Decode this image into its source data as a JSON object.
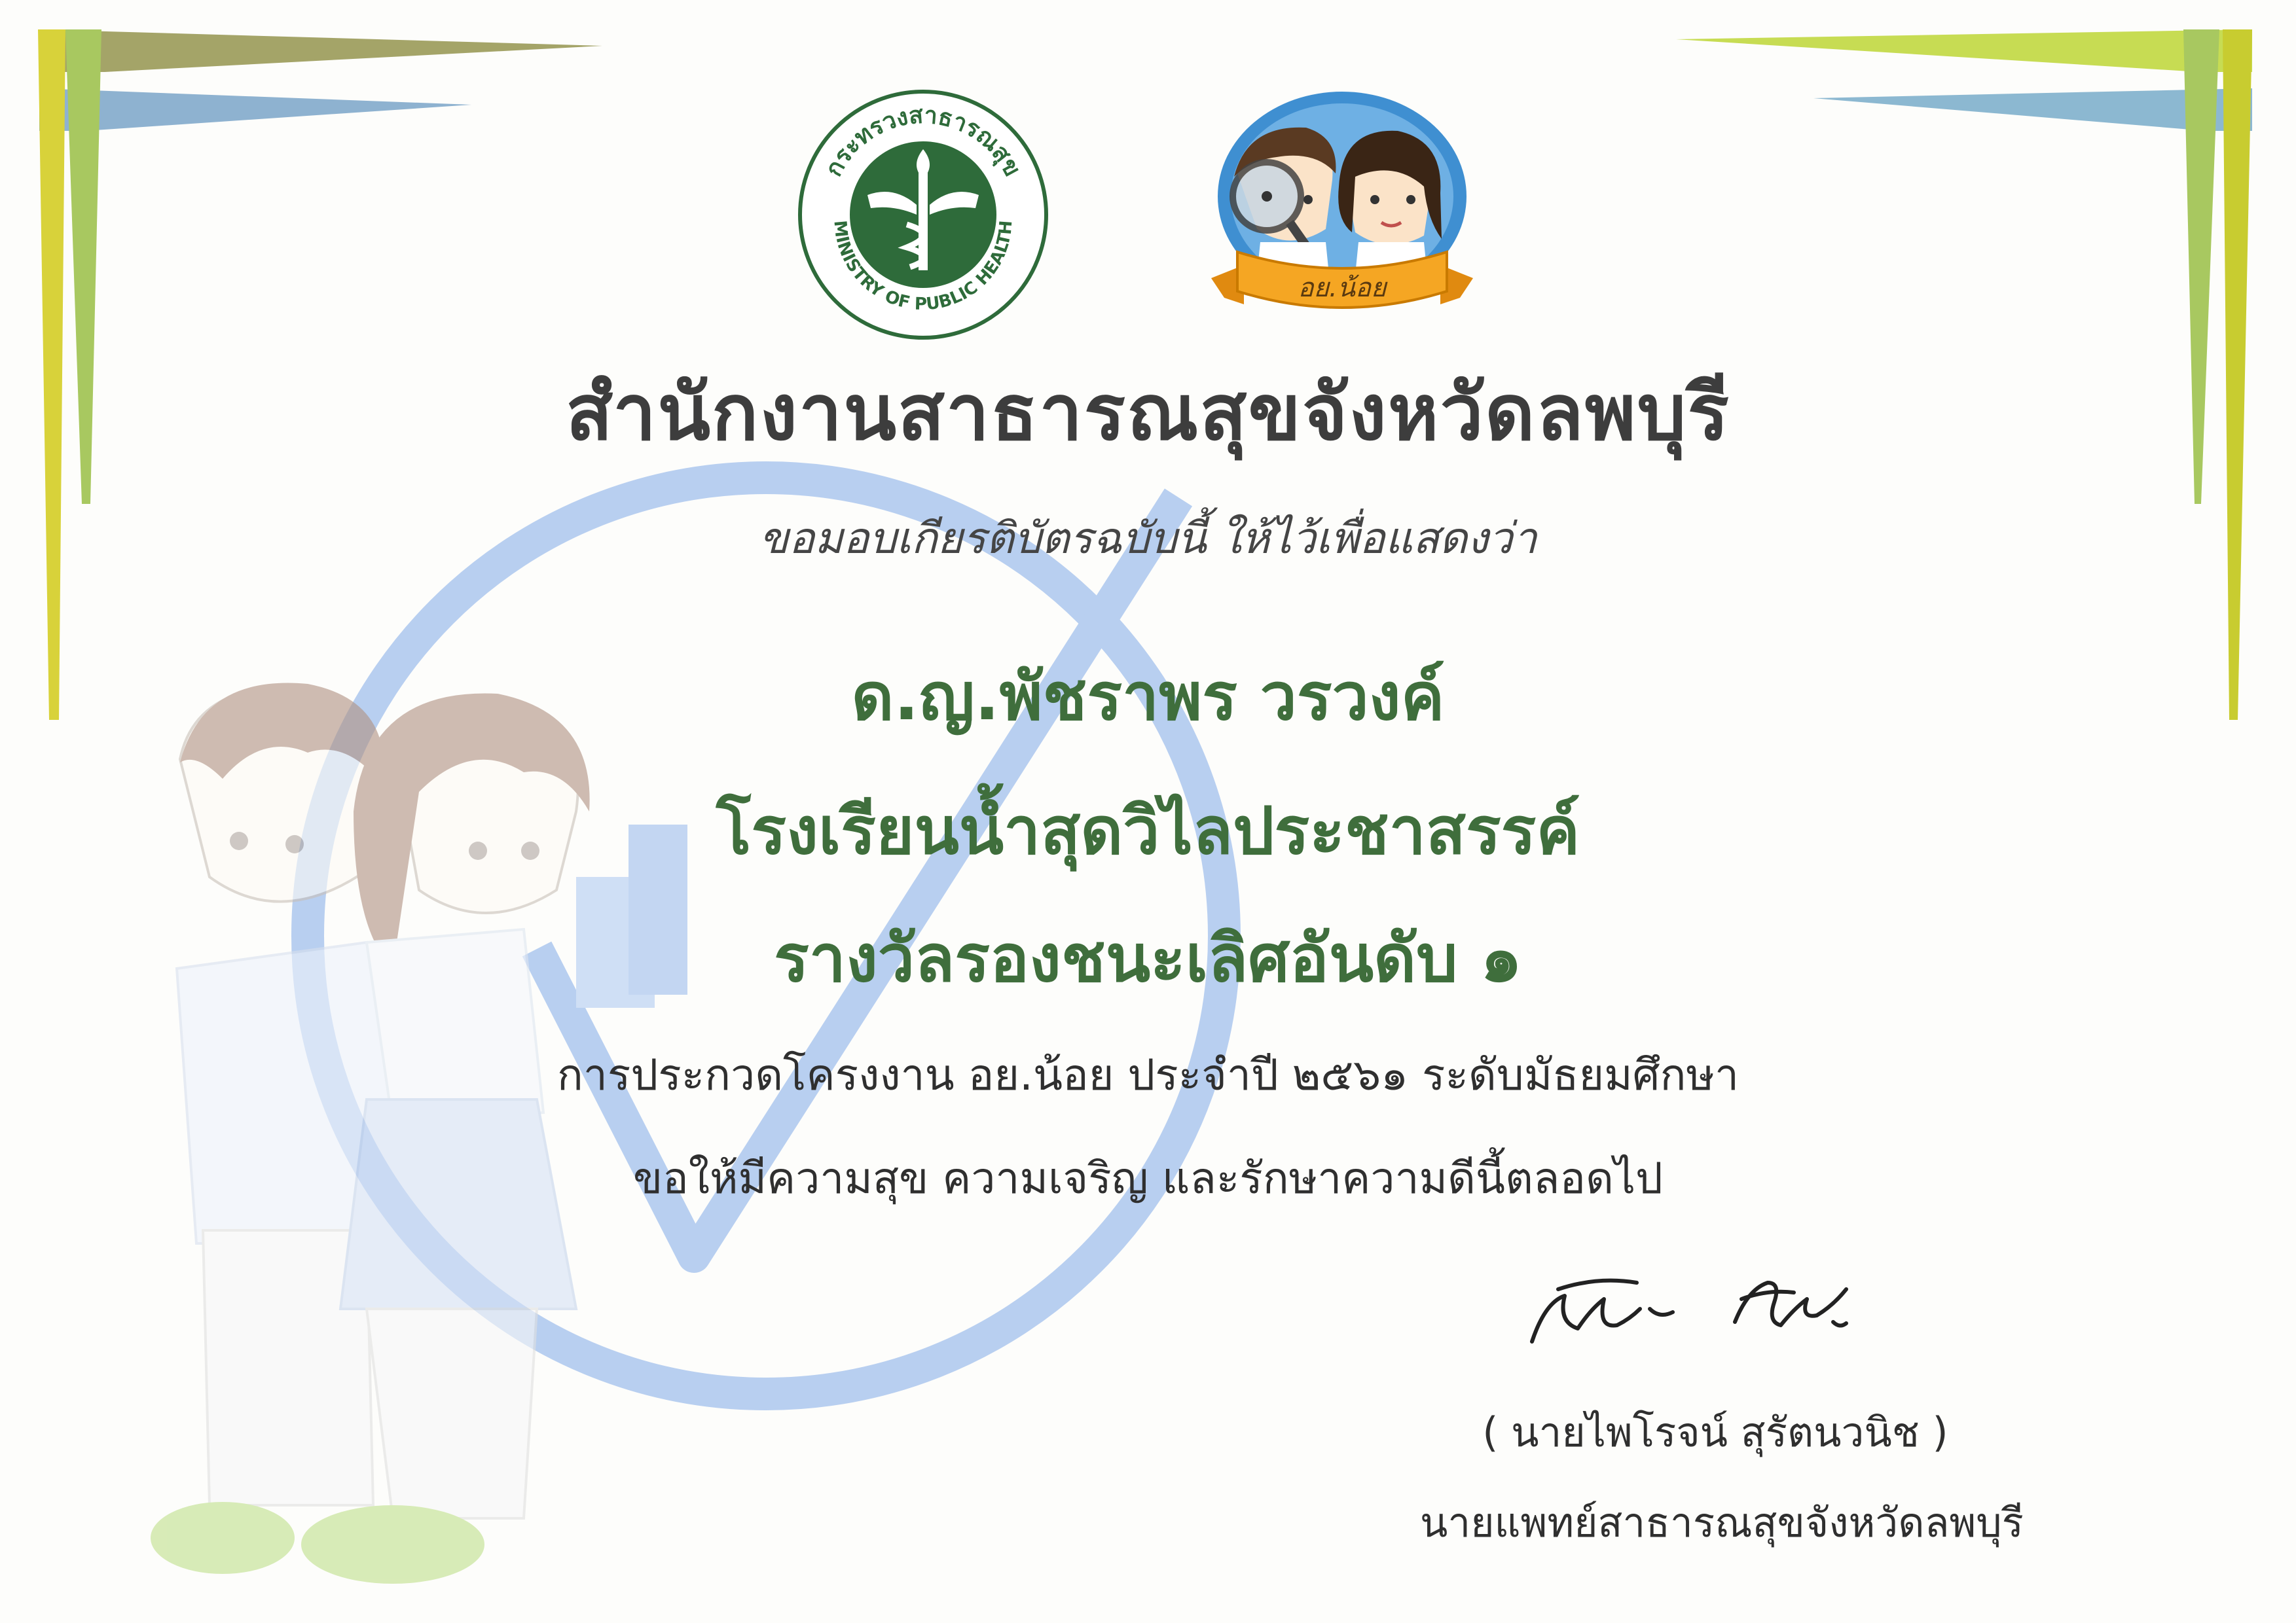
{
  "certificate": {
    "title": "สำนักงานสาธารณสุขจังหวัดลพบุรี",
    "subtitle": "ขอมอบเกียรติบัตรฉบับนี้ ให้ไว้เพื่อแสดงว่า",
    "recipient_name": "ด.ญ.พัชราพร วรวงค์",
    "school": "โรงเรียนน้ำสุดวิไลประชาสรรค์",
    "award": "รางวัลรองชนะเลิศอันดับ ๑",
    "contest": "การประกวดโครงงาน อย.น้อย ประจำปี ๒๕๖๑ ระดับมัธยมศึกษา",
    "wish": "ขอให้มีความสุข  ความเจริญ  และรักษาความดีนี้ตลอดไป",
    "signer_name": "( นายไพโรจน์  สุรัตนวนิช )",
    "signer_title": "นายแพทย์สาธารณสุขจังหวัดลพบุรี"
  },
  "logos": {
    "moph_seal_text_top": "กระทรวงสาธารณสุข",
    "moph_seal_text_bottom": "MINISTRY OF PUBLIC HEALTH",
    "oryor_banner_text": "อย.น้อย"
  },
  "colors": {
    "title": "#3d3d3d",
    "highlight_green": "#3f6e3c",
    "seal_green": "#2e6b3a",
    "watermark_blue": "#b8cff0"
  }
}
